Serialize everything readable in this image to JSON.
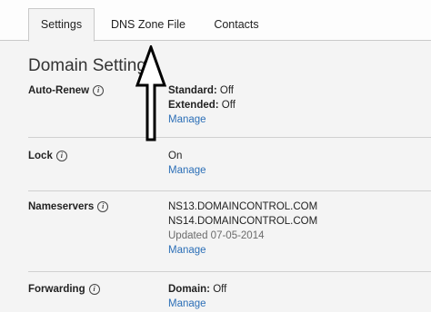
{
  "tabs": [
    {
      "label": "Settings",
      "active": true
    },
    {
      "label": "DNS Zone File",
      "active": false
    },
    {
      "label": "Contacts",
      "active": false
    }
  ],
  "section_title": "Domain Settings",
  "rows": {
    "auto_renew": {
      "label": "Auto-Renew",
      "standard_label": "Standard:",
      "standard_value": "Off",
      "extended_label": "Extended:",
      "extended_value": "Off",
      "manage": "Manage"
    },
    "lock": {
      "label": "Lock",
      "value": "On",
      "manage": "Manage"
    },
    "nameservers": {
      "label": "Nameservers",
      "ns1": "NS13.DOMAINCONTROL.COM",
      "ns2": "NS14.DOMAINCONTROL.COM",
      "updated": "Updated 07-05-2014",
      "manage": "Manage"
    },
    "forwarding": {
      "label": "Forwarding",
      "domain_label": "Domain:",
      "domain_value": "Off",
      "manage": "Manage"
    }
  },
  "icons": {
    "info": "info-icon",
    "annotation": "up-arrow-icon"
  },
  "colors": {
    "link": "#2c6fb7",
    "panel": "#f4f4f4",
    "border": "#c9c9c9"
  }
}
